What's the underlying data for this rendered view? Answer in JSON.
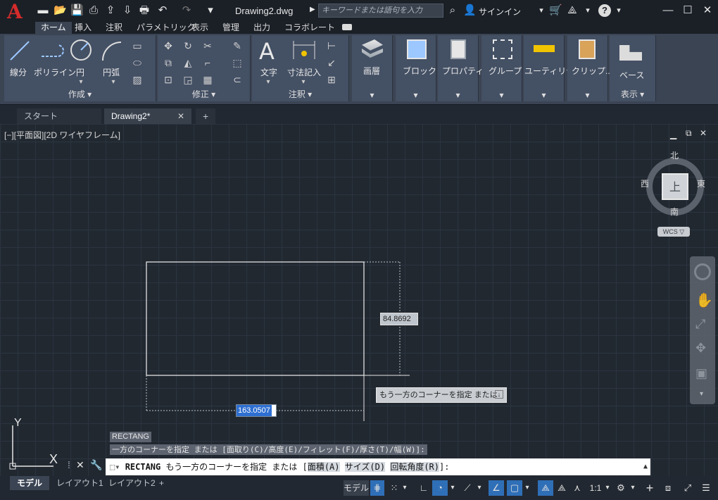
{
  "app": {
    "title": "Drawing2.dwg",
    "search_placeholder": "キーワードまたは語句を入力",
    "signin": "サインイン"
  },
  "ribbon_tabs": [
    "ホーム",
    "挿入",
    "注釈",
    "パラメトリック",
    "表示",
    "管理",
    "出力",
    "コラボレート"
  ],
  "panels": {
    "draw": {
      "label": "作成 ▾",
      "line": "線分",
      "polyline": "ポリライン",
      "circle": "円",
      "arc": "円弧"
    },
    "modify": {
      "label": "修正 ▾"
    },
    "annotation": {
      "label": "注釈 ▾",
      "text": "文字",
      "dimension": "寸法記入"
    },
    "layers": "画層",
    "block": "ブロック",
    "properties": "プロパティ",
    "groups": "グループ",
    "utilities": "ユーティリティ",
    "clipboard": "クリップ...",
    "view": {
      "base": "ベース",
      "label": "表示 ▾"
    }
  },
  "doc_tabs": {
    "start": "スタート",
    "drawing": "Drawing2*",
    "close": "✕",
    "add": "+"
  },
  "viewport_label": "[−][平面図][2D ワイヤフレーム]",
  "viewcube": {
    "north": "北",
    "south": "南",
    "east": "東",
    "west": "西",
    "top": "上",
    "wcs": "WCS ▽"
  },
  "dimension_inputs": {
    "height": "84.8692",
    "width": "163.0507"
  },
  "tooltip": "もう一方のコーナーを指定 または",
  "command_history": {
    "cmd": "RECTANG",
    "line": "一方のコーナーを指定 または [面取り(C)/高度(E)/フィレット(F)/厚さ(T)/幅(W)]:"
  },
  "command_line": {
    "cmd": "RECTANG",
    "prompt": "もう一方のコーナーを指定 または [",
    "opt1": "面積(A)",
    "opt2": "サイズ(D)",
    "opt3": "回転角度(R)",
    "end": "]:"
  },
  "layout_tabs": [
    "モデル",
    "レイアウト1",
    "レイアウト2"
  ],
  "status": {
    "model": "モデル",
    "scale": "1:1"
  },
  "ucs": {
    "y": "Y",
    "x": "X"
  }
}
